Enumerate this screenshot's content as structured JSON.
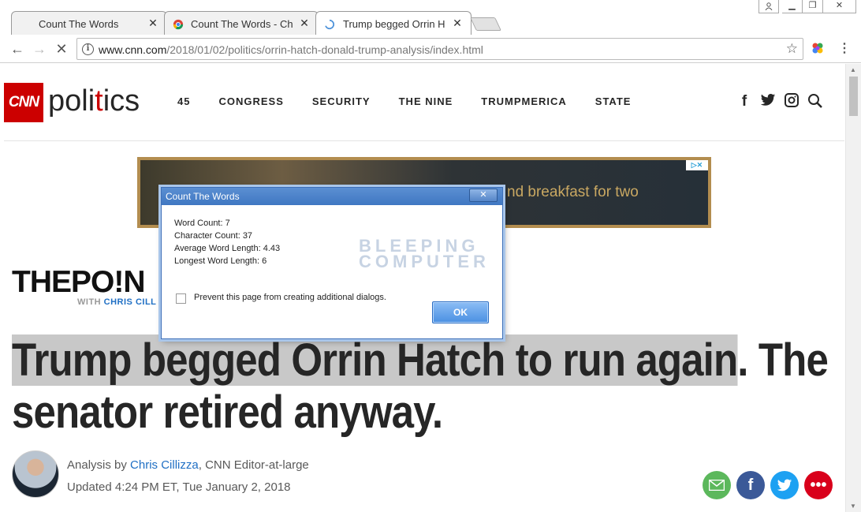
{
  "browser": {
    "tabs": [
      {
        "title": "Count The Words",
        "active": false
      },
      {
        "title": "Count The Words - Chrome",
        "active": false
      },
      {
        "title": "Trump begged Orrin Hatch",
        "active": true
      }
    ],
    "url_host": "www.cnn.com",
    "url_path": "/2018/01/02/politics/orrin-hatch-donald-trump-analysis/index.html",
    "close_glyph": "✕"
  },
  "cnn": {
    "logo": "CNN",
    "section_pre": "poli",
    "section_red": "t",
    "section_post": "ics",
    "nav": [
      "45",
      "CONGRESS",
      "SECURITY",
      "THE NINE",
      "TRUMPMERICA",
      "STATE"
    ],
    "social_icons": [
      "facebook-icon",
      "twitter-icon",
      "instagram-icon",
      "search-icon"
    ]
  },
  "ad": {
    "text": "nd breakfast for two",
    "choice": "▷✕"
  },
  "article": {
    "series_bold": "THE",
    "series_light": "PO!N",
    "series_with": "WITH ",
    "series_host": "CHRIS CILL",
    "headline_highlight": "Trump begged Orrin Hatch to run again",
    "headline_rest": ". The senator retired anyway.",
    "byline_pre": "Analysis by ",
    "byline_author": "Chris Cillizza",
    "byline_post": ", CNN Editor-at-large",
    "updated": "Updated 4:24 PM ET, Tue January 2, 2018"
  },
  "dialog": {
    "title": "Count The Words",
    "lines": [
      "Word Count: 7",
      "Character Count: 37",
      "Average Word Length: 4.43",
      "Longest Word Length: 6"
    ],
    "watermark_1": "BLEEPING",
    "watermark_2": "COMPUTER",
    "checkbox_label": "Prevent this page from creating additional dialogs.",
    "ok_label": "OK"
  },
  "colors": {
    "cnn_red": "#cc0000",
    "dialog_title": "#3f77c2",
    "share_email": "#5cb85c",
    "share_facebook": "#3b5998",
    "share_twitter": "#1da1f2",
    "share_more": "#d9001b"
  }
}
